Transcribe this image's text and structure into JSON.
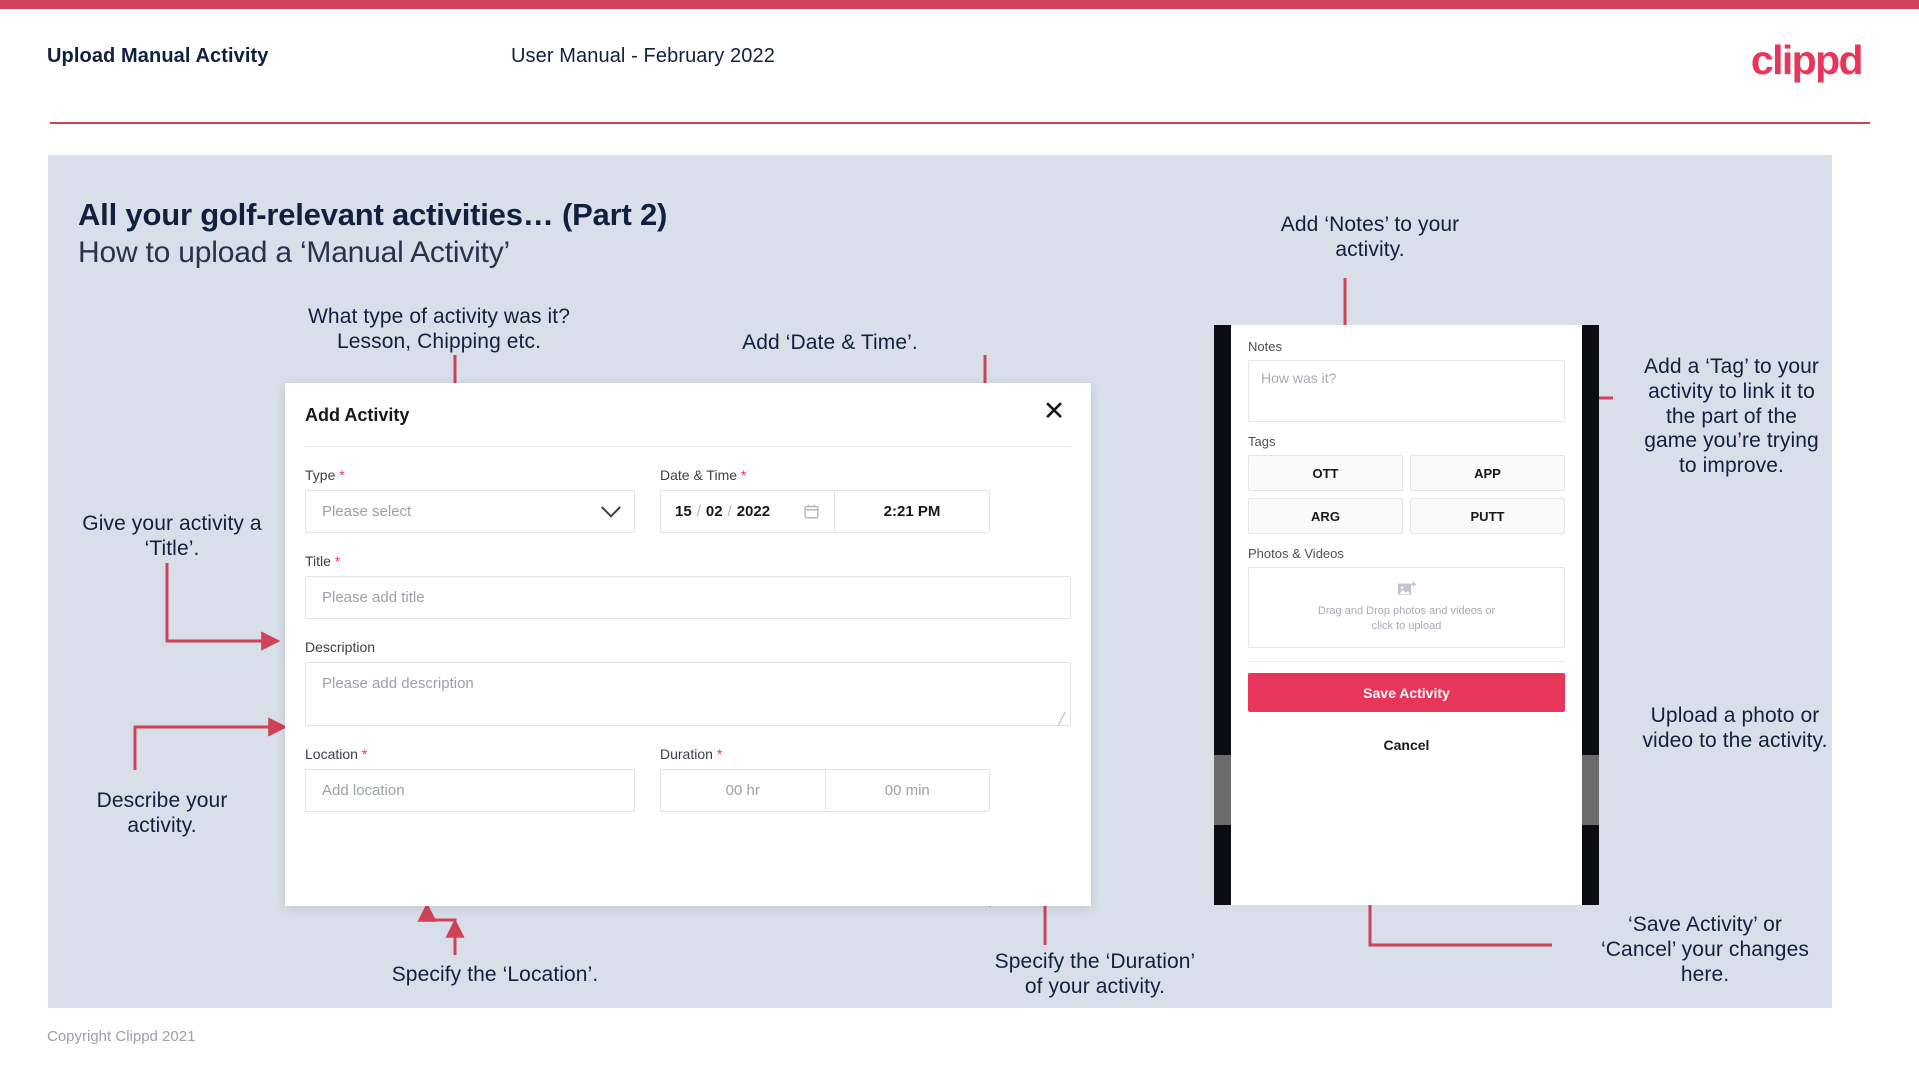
{
  "theme": {
    "accent": "#e8365a",
    "strip": "#cf4257",
    "arrow": "#cf4257",
    "slide_bg": "#d9dfe8",
    "ink": "#10213f"
  },
  "header": {
    "title": "Upload Manual Activity",
    "subtitle": "User Manual - February 2022",
    "logo": "clippd"
  },
  "slide": {
    "title": "All your golf-relevant activities… (Part 2)",
    "subtitle": "How to upload a ‘Manual Activity’"
  },
  "annotations": {
    "type": "What type of activity was it?\nLesson, Chipping etc.",
    "datetime": "Add ‘Date & Time’.",
    "title": "Give your activity a\n‘Title’.",
    "description": "Describe your\nactivity.",
    "location": "Specify the ‘Location’.",
    "duration": "Specify the ‘Duration’\nof your activity.",
    "notes": "Add ‘Notes’ to your\nactivity.",
    "tags": "Add a ‘Tag’ to your\nactivity to link it to\nthe part of the\ngame you’re trying\nto improve.",
    "photos": "Upload a photo or\nvideo to the activity.",
    "save": "‘Save Activity’ or\n‘Cancel’ your changes\nhere."
  },
  "dialog": {
    "title": "Add Activity",
    "close_icon": "close-icon",
    "fields": {
      "type": {
        "label": "Type",
        "required": "*",
        "value": "Please select",
        "chevron_icon": "chevron-down-icon"
      },
      "datetime": {
        "label": "Date & Time",
        "required": "*",
        "day": "15",
        "sep1": "/",
        "month": "02",
        "sep2": "/",
        "year": "2022",
        "calendar_icon": "calendar-icon",
        "time": "2:21 PM"
      },
      "title": {
        "label": "Title",
        "required": "*",
        "placeholder": "Please add title"
      },
      "description": {
        "label": "Description",
        "required": "",
        "placeholder": "Please add description"
      },
      "location": {
        "label": "Location",
        "required": "*",
        "placeholder": "Add location"
      },
      "duration": {
        "label": "Duration",
        "required": "*",
        "hours": "00 hr",
        "minutes": "00 min"
      }
    }
  },
  "phone": {
    "notes": {
      "label": "Notes",
      "placeholder": "How was it?"
    },
    "tags": {
      "label": "Tags",
      "items": [
        "OTT",
        "APP",
        "ARG",
        "PUTT"
      ]
    },
    "photos": {
      "label": "Photos & Videos",
      "icon": "add-image-icon",
      "drop_text_line1": "Drag and Drop photos and videos or",
      "drop_text_line2": "click to upload"
    },
    "save_label": "Save Activity",
    "cancel_label": "Cancel"
  },
  "footer": {
    "copyright": "Copyright Clippd 2021"
  }
}
